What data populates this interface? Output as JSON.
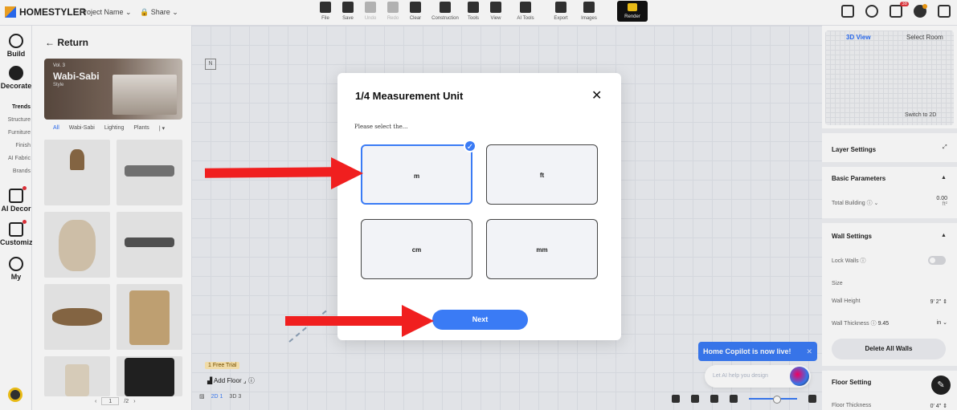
{
  "app": {
    "name": "HOMESTYLER",
    "project_name": "Project Name",
    "share": "Share"
  },
  "toolbar": {
    "items": [
      "File",
      "Save",
      "Undo",
      "Redo",
      "Clear",
      "Construction",
      "Tools",
      "View",
      "AI Tools",
      "Export",
      "Images",
      "Render"
    ],
    "ai_badge": "NEW"
  },
  "topright": {
    "notif_count": "38"
  },
  "leftrail": {
    "build": "Build",
    "decorate": "Decorate",
    "subs": [
      "Trends",
      "Structure",
      "Furniture",
      "Finish",
      "AI Fabric",
      "Brands"
    ],
    "ai_decor": "AI Decor",
    "customize": "Customize",
    "my": "My"
  },
  "catalog": {
    "return": "← Return",
    "banner": {
      "vol": "Vol. 3",
      "title": "Wabi-Sabi",
      "style": "Style"
    },
    "tabs": [
      "All",
      "Wabi-Sabi",
      "Lighting",
      "Plants"
    ],
    "pager": {
      "page": "1",
      "total": "/2"
    }
  },
  "dialog": {
    "title": "1/4 Measurement Unit",
    "subtitle": "Please select the...",
    "units": [
      "m",
      "ft",
      "cm",
      "mm"
    ],
    "selected": "m",
    "next": "Next",
    "close": "✕"
  },
  "rightpanel": {
    "tab_3d": "3D View",
    "tab_room": "Select Room",
    "switch_2d": "Switch to 2D",
    "layer_settings": "Layer Settings",
    "basic_params": "Basic Parameters",
    "total_building": "Total Building",
    "total_value": "0.00",
    "total_unit": "ft²",
    "wall_settings": "Wall Settings",
    "lock_walls": "Lock Walls",
    "size": "Size",
    "wall_height": "Wall Height",
    "wall_height_val": "9' 2\"",
    "wall_thickness": "Wall Thickness",
    "wall_thickness_val": "9.45",
    "wall_thickness_unit": "in",
    "delete_all": "Delete All Walls",
    "floor_setting": "Floor Setting",
    "floor_thickness": "Floor Thickness",
    "floor_thickness_val": "0' 4\""
  },
  "bottom": {
    "free_trial": "1 Free Trial",
    "add_floor": "Add Floor",
    "view2d": "2D 1",
    "view3d": "3D 3"
  },
  "copilot": {
    "banner": "Home Copilot is now live!",
    "placeholder": "Let AI help you design"
  },
  "colors": {
    "accent": "#3a7bf5",
    "arrow": "#f01f1f"
  }
}
